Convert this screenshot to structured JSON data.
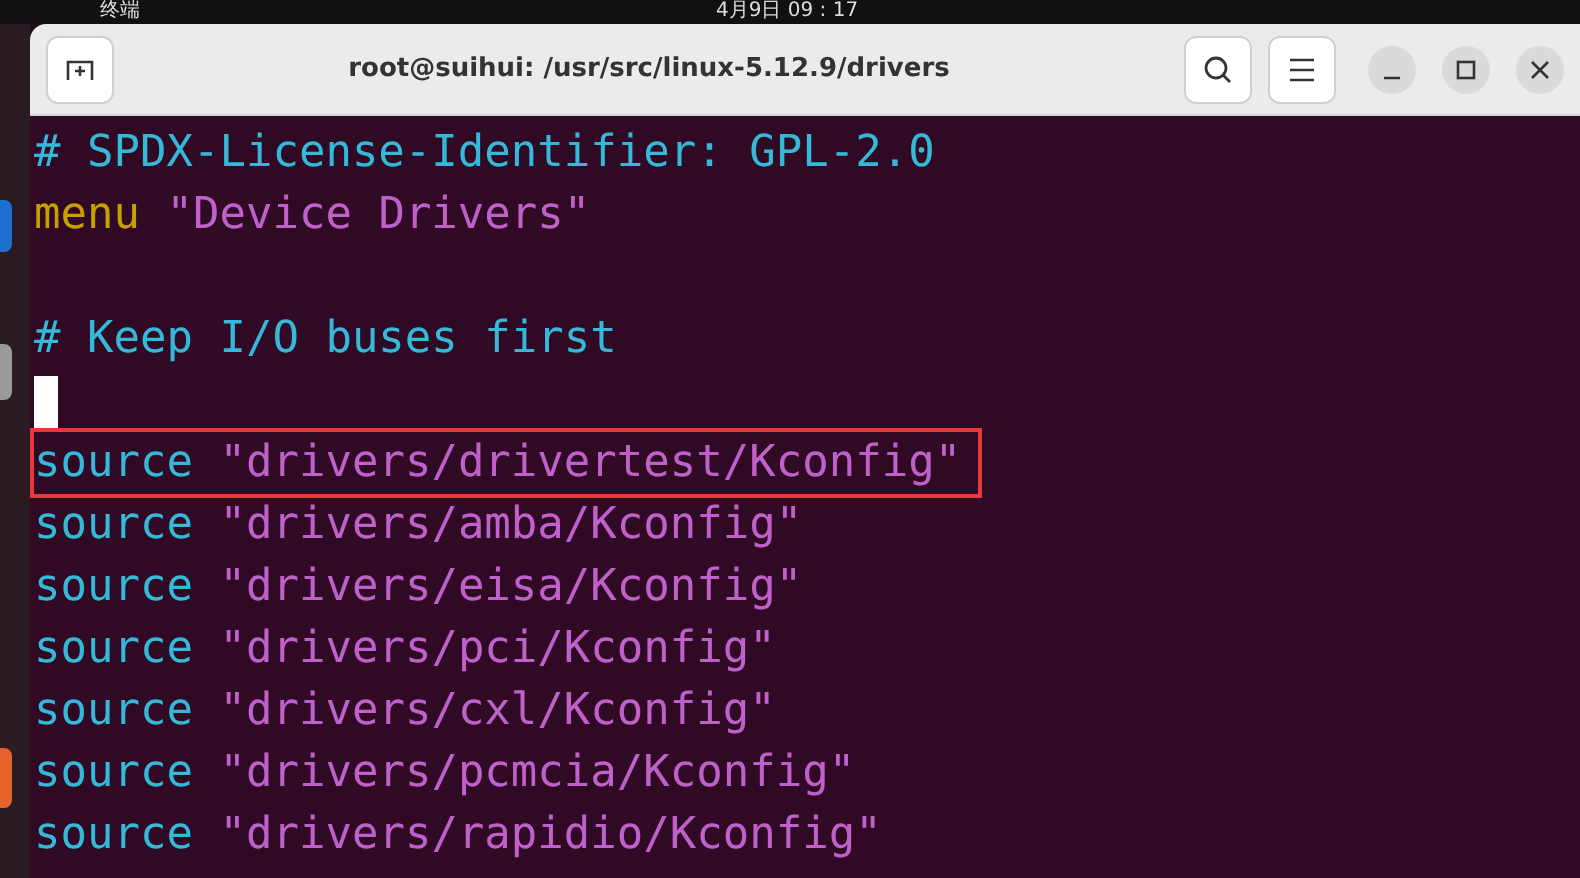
{
  "top_bar": {
    "app_name": "终端",
    "clock": "4月9日 09 : 17"
  },
  "window": {
    "title": "root@suihui: /usr/src/linux-5.12.9/drivers"
  },
  "terminal": {
    "lines": [
      {
        "highlighted": false,
        "segments": [
          {
            "kind": "comment",
            "text": "# SPDX-License-Identifier: GPL-2.0"
          }
        ]
      },
      {
        "highlighted": false,
        "segments": [
          {
            "kind": "keyword",
            "text": "menu"
          },
          {
            "kind": "string",
            "text": "\"Device Drivers\""
          }
        ]
      },
      {
        "highlighted": false
      },
      {
        "highlighted": false,
        "segments": [
          {
            "kind": "comment",
            "text": "# Keep I/O buses first"
          }
        ]
      },
      {
        "highlighted": false,
        "segments": [
          {
            "kind": "cursor"
          }
        ]
      },
      {
        "highlighted": true,
        "segments": [
          {
            "kind": "command",
            "text": "source"
          },
          {
            "kind": "string",
            "text": "\"drivers/drivertest/Kconfig\""
          }
        ]
      },
      {
        "highlighted": false,
        "segments": [
          {
            "kind": "command",
            "text": "source"
          },
          {
            "kind": "string",
            "text": "\"drivers/amba/Kconfig\""
          }
        ]
      },
      {
        "highlighted": false,
        "segments": [
          {
            "kind": "command",
            "text": "source"
          },
          {
            "kind": "string",
            "text": "\"drivers/eisa/Kconfig\""
          }
        ]
      },
      {
        "highlighted": false,
        "segments": [
          {
            "kind": "command",
            "text": "source"
          },
          {
            "kind": "string",
            "text": "\"drivers/pci/Kconfig\""
          }
        ]
      },
      {
        "highlighted": false,
        "segments": [
          {
            "kind": "command",
            "text": "source"
          },
          {
            "kind": "string",
            "text": "\"drivers/cxl/Kconfig\""
          }
        ]
      },
      {
        "highlighted": false,
        "segments": [
          {
            "kind": "command",
            "text": "source"
          },
          {
            "kind": "string",
            "text": "\"drivers/pcmcia/Kconfig\""
          }
        ]
      },
      {
        "highlighted": false,
        "segments": [
          {
            "kind": "command",
            "text": "source"
          },
          {
            "kind": "string",
            "text": "\"drivers/rapidio/Kconfig\""
          }
        ]
      }
    ]
  }
}
